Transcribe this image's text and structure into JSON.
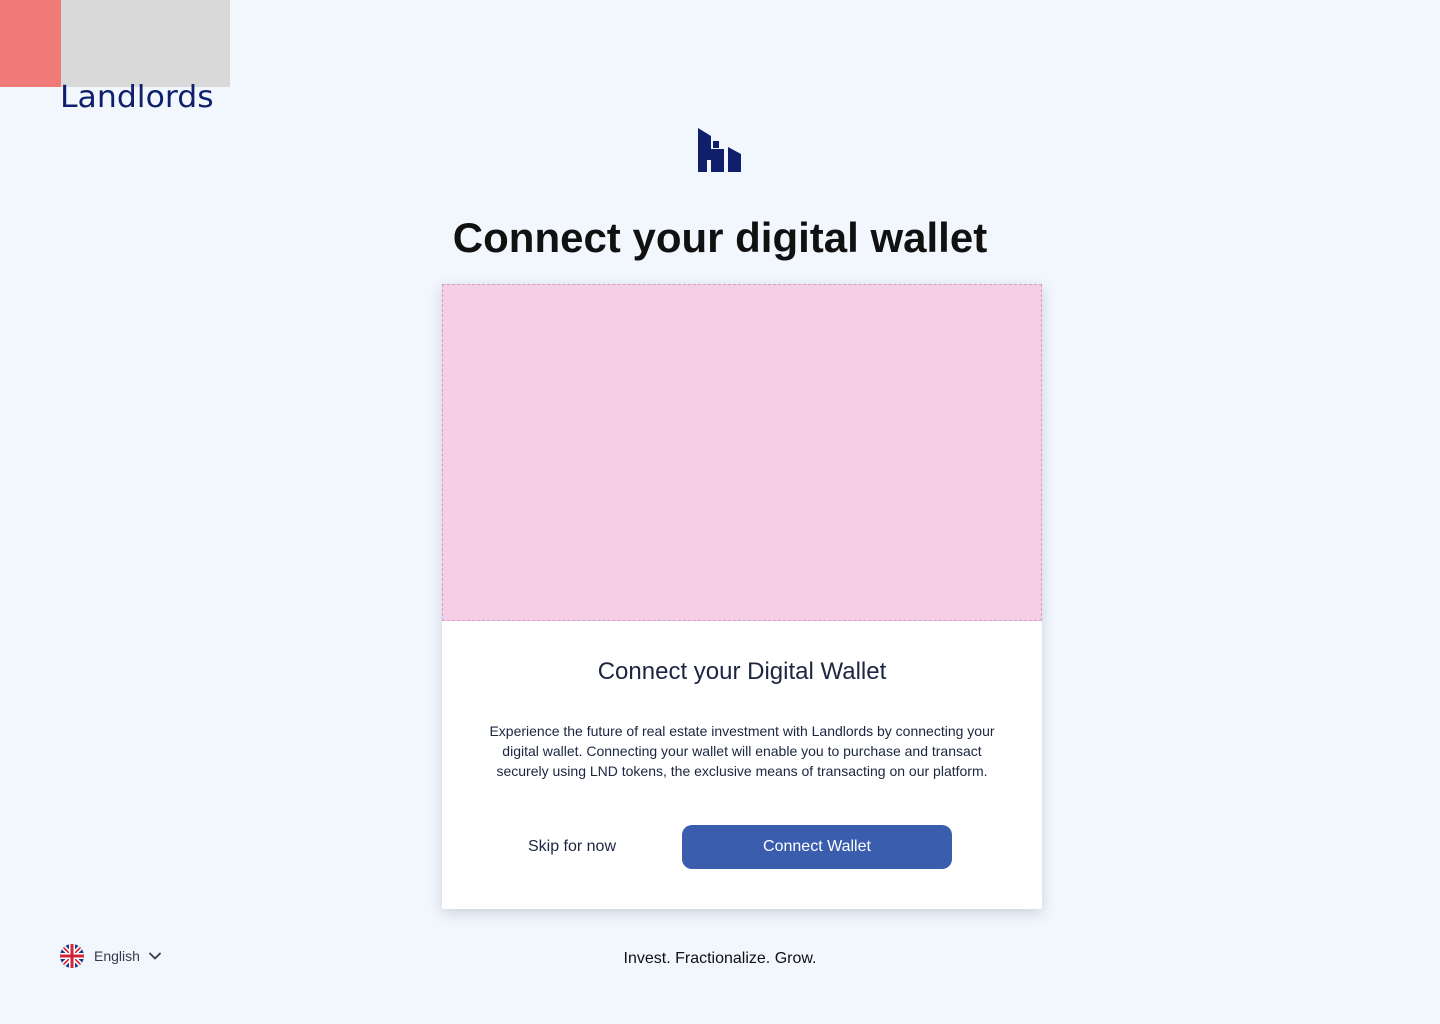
{
  "brand": {
    "name": "Landlords"
  },
  "colors": {
    "background": "#f2f7fd",
    "brand_navy": "#0f1f6b",
    "accent_red": "#f07a78",
    "placeholder_pink": "#f5cee8",
    "button_blue": "#3a5dae"
  },
  "page": {
    "title": "Connect your digital wallet"
  },
  "card": {
    "title": "Connect your Digital Wallet",
    "description": "Experience the future of real estate investment with Landlords by connecting your digital wallet. Connecting your wallet will enable you to purchase and transact securely using LND tokens, the exclusive means of transacting on our platform.",
    "skip_label": "Skip for now",
    "connect_label": "Connect Wallet"
  },
  "footer": {
    "language": {
      "label": "English",
      "flag_icon": "uk-flag-icon",
      "chevron_icon": "chevron-down-icon"
    },
    "tagline": "Invest. Fractionalize. Grow."
  }
}
